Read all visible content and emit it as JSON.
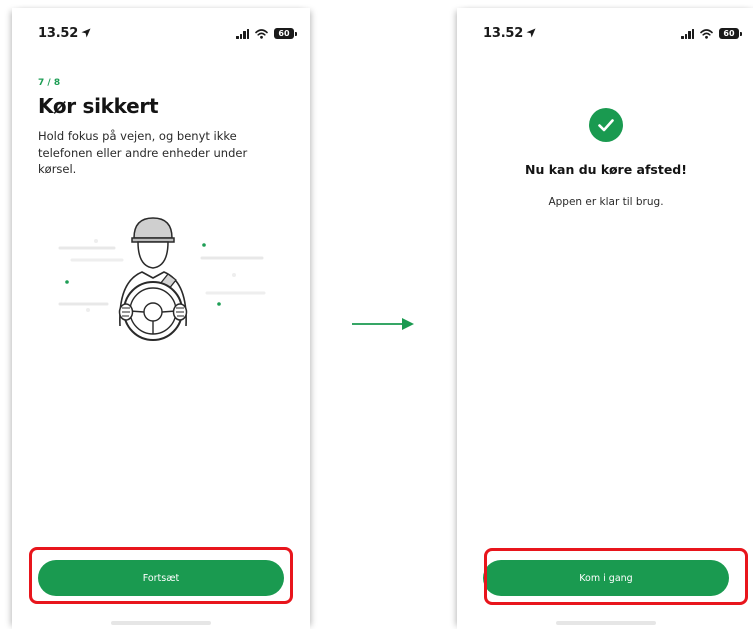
{
  "screens": [
    {
      "status": {
        "time": "13.52",
        "battery": "60"
      },
      "step_indicator": "7 / 8",
      "title": "Kør sikkert",
      "description": "Hold fokus på vejen, og benyt ikke telefonen eller andre enheder under kørsel.",
      "button_label": "Fortsæt"
    },
    {
      "status": {
        "time": "13.52",
        "battery": "60"
      },
      "title": "Nu kan du køre afsted!",
      "subtitle": "Appen er klar til brug.",
      "button_label": "Kom i gang"
    }
  ],
  "colors": {
    "accent_green": "#1a9a50",
    "step_green": "#1e9e55",
    "highlight_red": "#e8151c"
  },
  "icons": [
    "location-arrow-icon",
    "signal-icon",
    "wifi-icon",
    "battery-icon",
    "driver-illustration",
    "checkmark-icon",
    "arrow-right-icon"
  ]
}
